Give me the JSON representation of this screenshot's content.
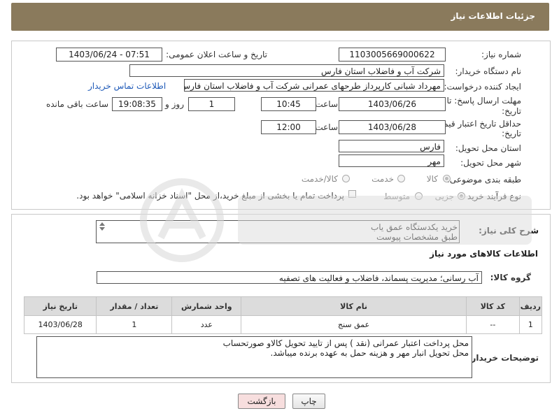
{
  "header": {
    "title": "جزئیات اطلاعات نیاز"
  },
  "fields": {
    "need_number_label": "شماره نیاز:",
    "need_number": "1103005669000622",
    "announce_label": "تاریخ و ساعت اعلان عمومی:",
    "announce_value": "1403/06/24 - 07:51",
    "buyer_org_label": "نام دستگاه خریدار:",
    "buyer_org": "شرکت آب و فاضلاب استان فارس",
    "creator_label": "ایجاد کننده درخواست:",
    "creator": "مهرداد شبانی کارپرداز طرحهای عمرانی  شرکت آب و فاضلاب استان فارس",
    "contact_link": "اطلاعات تماس خریدار",
    "deadline_label_1": "مهلت ارسال پاسخ: تا",
    "deadline_label_2": "تاریخ:",
    "deadline_date": "1403/06/26",
    "time_label": "ساعت",
    "deadline_time": "10:45",
    "days_value": "1",
    "days_label": "روز و",
    "remaining_time": "19:08:35",
    "remaining_label": "ساعت باقی مانده",
    "price_label_1": "حداقل تاریخ اعتبار قیمت: تا",
    "price_label_2": "تاریخ:",
    "price_date": "1403/06/28",
    "price_time_label": "ساعت",
    "price_time": "12:00",
    "province_label": "استان محل تحویل:",
    "province": "فارس",
    "city_label": "شهر محل تحویل:",
    "city": "مهر",
    "category_label": "طبقه بندی موضوعی:",
    "category_options": [
      "کالا",
      "خدمت",
      "کالا/خدمت"
    ],
    "purchase_type_label": "نوع فرآیند خرید :",
    "purchase_options": [
      "جزیی",
      "متوسط"
    ],
    "payment_note": "پرداخت تمام یا بخشی از مبلغ خرید،از محل \"اسناد خزانه اسلامی\" خواهد بود."
  },
  "summary": {
    "label": "شرح کلی نیاز:",
    "line1": "خرید یکدستگاه عمق یاب",
    "line2": "طبق مشخصات پیوست"
  },
  "goods": {
    "section_title": "اطلاعات کالاهای مورد نیاز",
    "group_label": "گروه کالا:",
    "group_value": "آب رسانی؛ مدیریت پسماند، فاضلاب و فعالیت های تصفیه",
    "columns": [
      "ردیف",
      "کد کالا",
      "نام کالا",
      "واحد شمارش",
      "تعداد / مقدار",
      "تاریخ نیاز"
    ],
    "rows": [
      {
        "row": "1",
        "code": "--",
        "name": "عمق سنج",
        "unit": "عدد",
        "qty": "1",
        "date": "1403/06/28"
      }
    ]
  },
  "buyer_notes": {
    "label": "توضیحات خریدار:",
    "line1": "محل پرداخت اعتبار عمرانی (نقد  ) پس از تایید تحویل کالاو صورتحساب",
    "line2": "محل تحویل انبار مهر و هزینه حمل به عهده برنده میباشد."
  },
  "buttons": {
    "print": "چاپ",
    "back": "بازگشت"
  },
  "colors": {
    "header_bg": "#8a7a5c",
    "link": "#1f5ab8",
    "back_button_bg": "#f7dede"
  }
}
